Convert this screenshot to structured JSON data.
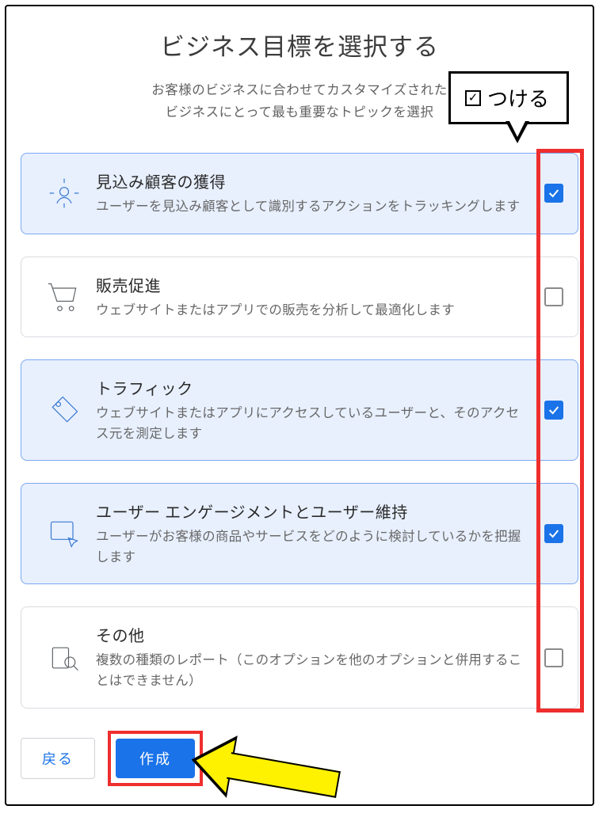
{
  "heading": "ビジネス目標を選択する",
  "subheading_line1": "お客様のビジネスに合わせてカスタマイズされた",
  "subheading_line2": "ビジネスにとって最も重要なトピックを選択",
  "callout_label": "つける",
  "options": [
    {
      "title": "見込み顧客の獲得",
      "desc": "ユーザーを見込み顧客として識別するアクションをトラッキングします",
      "checked": true,
      "icon": "target-user-icon"
    },
    {
      "title": "販売促進",
      "desc": "ウェブサイトまたはアプリでの販売を分析して最適化します",
      "checked": false,
      "icon": "cart-icon"
    },
    {
      "title": "トラフィック",
      "desc": "ウェブサイトまたはアプリにアクセスしているユーザーと、そのアクセス元を測定します",
      "checked": true,
      "icon": "tag-icon"
    },
    {
      "title": "ユーザー エンゲージメントとユーザー維持",
      "desc": "ユーザーがお客様の商品やサービスをどのように検討しているかを把握します",
      "checked": true,
      "icon": "window-cursor-icon"
    },
    {
      "title": "その他",
      "desc": "複数の種類のレポート（このオプションを他のオプションと併用することはできません）",
      "checked": false,
      "icon": "search-report-icon"
    }
  ],
  "footer": {
    "back_label": "戻る",
    "create_label": "作成"
  },
  "colors": {
    "accent": "#1a73e8",
    "highlight_red": "#ef2e2e",
    "arrow_yellow": "#fff200",
    "selected_bg": "#e8f0fe"
  }
}
